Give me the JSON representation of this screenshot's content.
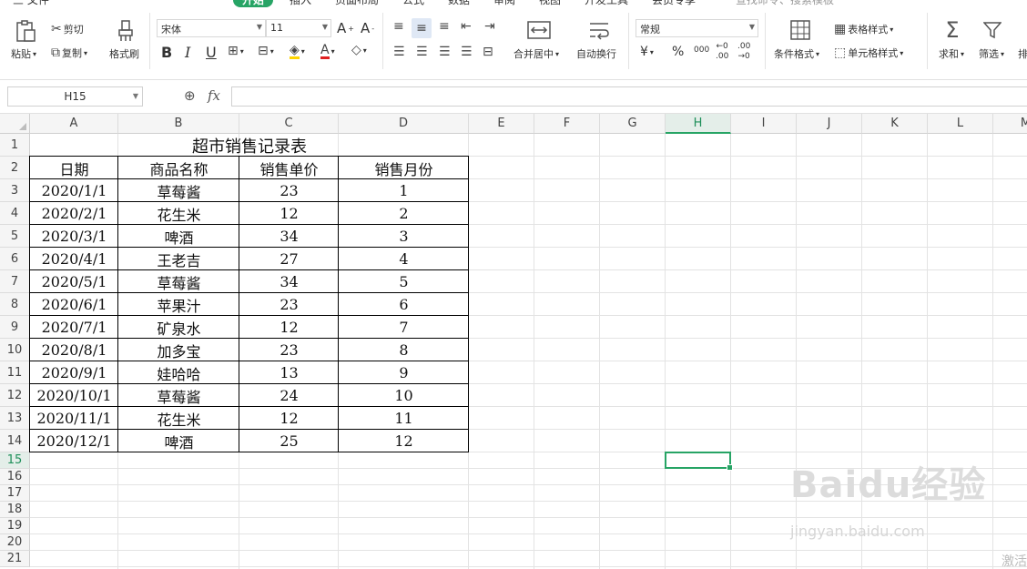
{
  "menu": {
    "items": [
      "三 文件",
      "开始",
      "插入",
      "页面布局",
      "公式",
      "数据",
      "审阅",
      "视图",
      "开发工具",
      "会员专享",
      "查找命令、搜索模板"
    ],
    "active_index": 1
  },
  "ribbon": {
    "paste": "粘贴",
    "cut": "剪切",
    "copy": "复制",
    "format_painter": "格式刷",
    "font_name": "宋体",
    "font_size": "11",
    "bold": "B",
    "italic": "I",
    "underline": "U",
    "merge_center": "合并居中",
    "wrap_text": "自动换行",
    "number_format": "常规",
    "currency": "¥",
    "percent": "%",
    "thousands": "000",
    "inc_decimal": ".00",
    "dec_decimal": ".00",
    "conditional_format": "条件格式",
    "table_style": "表格样式",
    "cell_style": "单元格样式",
    "sum": "求和",
    "filter": "筛选",
    "sort": "排"
  },
  "formula_bar": {
    "cell_ref": "H15",
    "fx": "fx",
    "value": ""
  },
  "columns": [
    "A",
    "B",
    "C",
    "D",
    "E",
    "F",
    "G",
    "H",
    "I",
    "J",
    "K",
    "L",
    "M"
  ],
  "active_column": "H",
  "active_row": "15",
  "rows": [
    "1",
    "2",
    "3",
    "4",
    "5",
    "6",
    "7",
    "8",
    "9",
    "10",
    "11",
    "12",
    "13",
    "14",
    "15",
    "16",
    "17",
    "18",
    "19",
    "20",
    "21"
  ],
  "sheet": {
    "title": "超市销售记录表",
    "headers": [
      "日期",
      "商品名称",
      "销售单价",
      "销售月份"
    ],
    "data": [
      [
        "2020/1/1",
        "草莓酱",
        "23",
        "1"
      ],
      [
        "2020/2/1",
        "花生米",
        "12",
        "2"
      ],
      [
        "2020/3/1",
        "啤酒",
        "34",
        "3"
      ],
      [
        "2020/4/1",
        "王老吉",
        "27",
        "4"
      ],
      [
        "2020/5/1",
        "草莓酱",
        "34",
        "5"
      ],
      [
        "2020/6/1",
        "苹果汁",
        "23",
        "6"
      ],
      [
        "2020/7/1",
        "矿泉水",
        "12",
        "7"
      ],
      [
        "2020/8/1",
        "加多宝",
        "23",
        "8"
      ],
      [
        "2020/9/1",
        "娃哈哈",
        "13",
        "9"
      ],
      [
        "2020/10/1",
        "草莓酱",
        "24",
        "10"
      ],
      [
        "2020/11/1",
        "花生米",
        "12",
        "11"
      ],
      [
        "2020/12/1",
        "啤酒",
        "25",
        "12"
      ]
    ]
  },
  "watermark": {
    "brand": "Baidu经验",
    "url": "jingyan.baidu.com"
  },
  "activate_hint": "激活"
}
